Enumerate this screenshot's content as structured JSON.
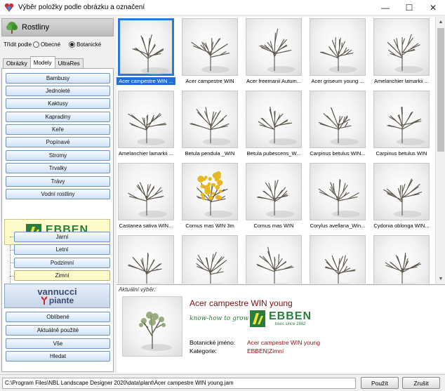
{
  "window": {
    "title": "Výběr položky podle obrázku a označení"
  },
  "category": {
    "label": "Rostliny"
  },
  "sort": {
    "label": "Třídit podle",
    "options": [
      "Obecné",
      "Botanické"
    ],
    "selected": "Botanické"
  },
  "tabs": [
    "Obrázky",
    "Modely",
    "UltraRes"
  ],
  "active_tab": "Modely",
  "categories": [
    "Bambusy",
    "Jednoleté",
    "Kaktusy",
    "Kapradiny",
    "Keře",
    "Popínavé",
    "Stromy",
    "Trvalky",
    "Trávy",
    "Vodní rostliny"
  ],
  "ebben": {
    "brand": "EBBEN",
    "tagline": "trees since 1862",
    "items": [
      "Jarní",
      "Letní",
      "Podzimní",
      "Zimní"
    ],
    "selected": "Zimní"
  },
  "vannucci": {
    "line1": "vannucci",
    "line2": "piante"
  },
  "bottom_buttons": [
    "Oblíbené",
    "Aktuálně použité",
    "Vše",
    "Hledat"
  ],
  "grid": [
    "Acer campestre WIN ...",
    "Acer campestre WIN",
    "Acer freemanii Autum...",
    "Acer griseum young ...",
    "Amelanchier lamarkii ...",
    "Amelanchier lamarkii ...",
    "Betula pendula _WIN",
    "Betula pubescens_W...",
    "Carpinus betulus WIN...",
    "Carpinus betulus WIN",
    "Castanea sativa WIN...",
    "Cornus mas WIN 3m",
    "Cornus mas WIN",
    "Corylus avellana_Win...",
    "Cydonia oblonga WIN..."
  ],
  "selected_index": 0,
  "info": {
    "heading": "Aktuální výběr:",
    "name": "Acer campestre WIN young",
    "slogan": "know-how to grow",
    "botanical_label": "Botanické jméno:",
    "botanical_value": "Acer campestre WIN young",
    "category_label": "Kategorie:",
    "category_value": "EBBEN|Zimní"
  },
  "path": "C:\\Program Files\\NBL Landscape Designer 2020\\data\\plant\\Acer campestre WIN young.jam",
  "actions": {
    "use": "Použít",
    "cancel": "Zrušit"
  },
  "colors": {
    "selection": "#1f6fd6",
    "ebben_green": "#2a7d3c",
    "ebben_yellow": "#f3e23a",
    "detail_red": "#8a1010"
  }
}
